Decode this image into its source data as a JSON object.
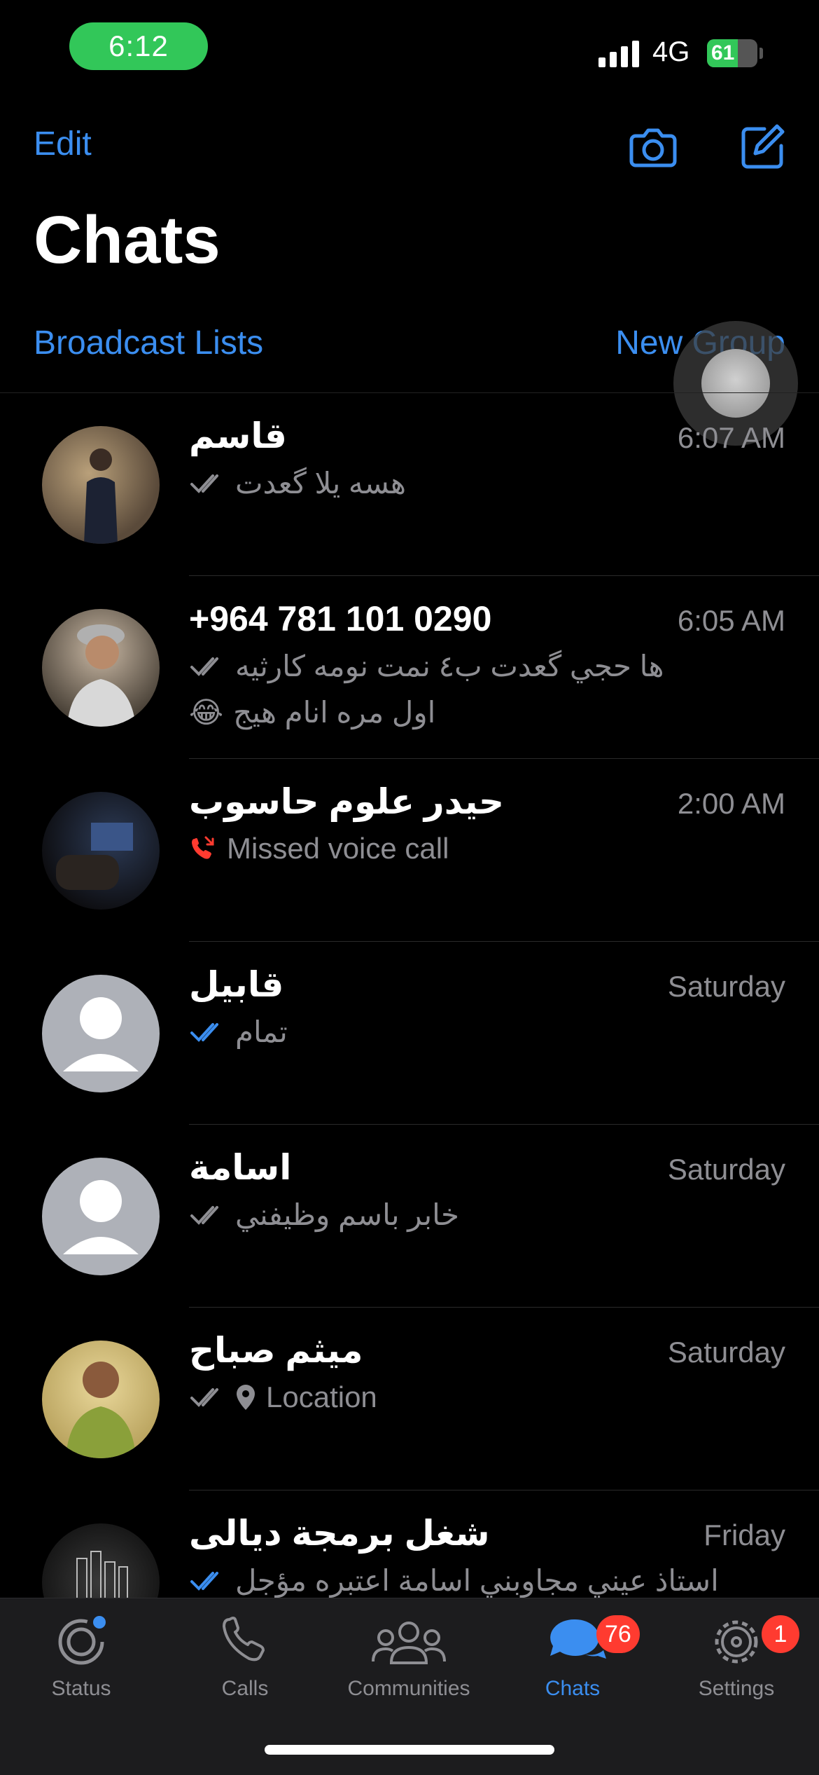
{
  "status_bar": {
    "time": "6:12",
    "network": "4G",
    "battery": "61",
    "battery_level": 0.61
  },
  "header": {
    "edit_label": "Edit",
    "title": "Chats",
    "broadcast_label": "Broadcast Lists",
    "new_group_label": "New Group"
  },
  "chats": [
    {
      "name": "قاسم",
      "time": "6:07 AM",
      "preview": "هسه يلا گعدت",
      "preview_line2": "",
      "ticks": "gray",
      "kind": "text"
    },
    {
      "name": "+964 781 101 0290",
      "time": "6:05 AM",
      "preview": "ها حجي گعدت ب٤ نمت نومه كارثيه",
      "preview_line2": "اول مره انام هيج",
      "emoji": "😂",
      "ticks": "gray",
      "kind": "text"
    },
    {
      "name": "حيدر علوم حاسوب",
      "time": "2:00 AM",
      "preview": "Missed voice call",
      "preview_line2": "",
      "ticks": "none",
      "kind": "missed-call"
    },
    {
      "name": "قابيل",
      "time": "Saturday",
      "preview": "تمام",
      "preview_line2": "",
      "ticks": "blue",
      "kind": "text"
    },
    {
      "name": "اسامة",
      "time": "Saturday",
      "preview": "خابر باسم وظيفني",
      "preview_line2": "",
      "ticks": "gray",
      "kind": "text"
    },
    {
      "name": "ميثم صباح",
      "time": "Saturday",
      "preview": "Location",
      "preview_line2": "",
      "ticks": "gray",
      "kind": "location"
    },
    {
      "name": "شغل برمجة ديالى",
      "time": "Friday",
      "preview": "استاذ عيني مجاوبني اسامة اعتبره مؤجل",
      "preview_line2": "",
      "ticks": "blue",
      "kind": "text"
    }
  ],
  "tabs": [
    {
      "label": "Status",
      "icon": "status-icon"
    },
    {
      "label": "Calls",
      "icon": "phone-icon"
    },
    {
      "label": "Communities",
      "icon": "communities-icon"
    },
    {
      "label": "Chats",
      "icon": "chats-icon",
      "badge": "76",
      "active": true
    },
    {
      "label": "Settings",
      "icon": "gear-icon",
      "badge": "1"
    }
  ],
  "colors": {
    "accent": "#3b8ef0",
    "badge": "#ff3b30",
    "muted": "#8e8e93",
    "pill": "#32c759",
    "missed": "#ff3b30"
  }
}
